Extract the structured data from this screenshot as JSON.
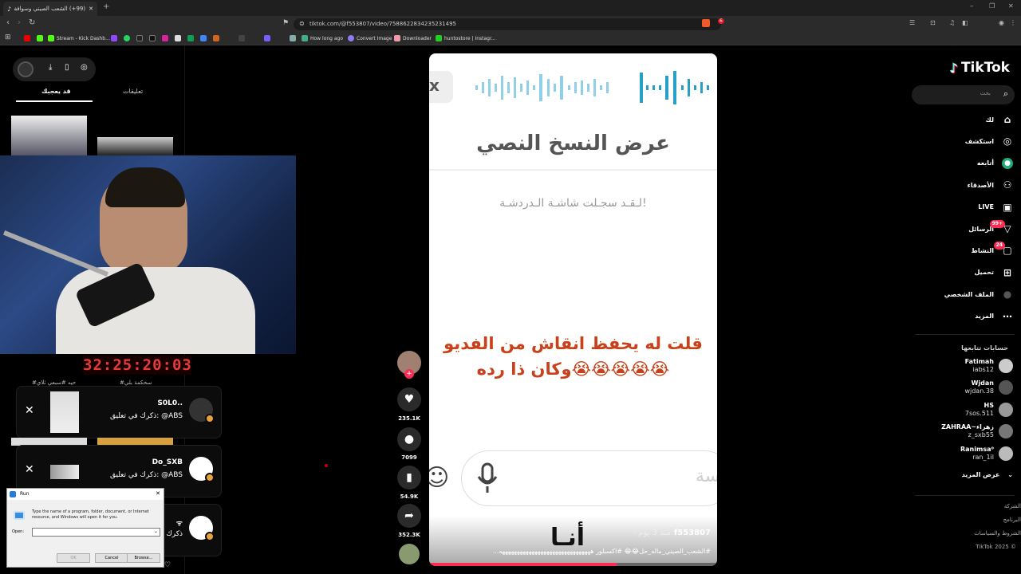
{
  "browser": {
    "tab_title": "(99+) الشعب الصيني وسوافف مثـ",
    "url": "tiktok.com/@f553807/video/7588622834235231495",
    "notif_count": "6",
    "bookmarks": [
      "Stream - Kick Dashb...",
      "How long ago",
      "Convert Image",
      "Downloader",
      "huntostore | Instagr..."
    ]
  },
  "left": {
    "tab_liked": "قد يعجبك",
    "tab_comments": "تعليقات",
    "timer": "32:25:20:03",
    "partial_labels": [
      "#سحكمة بلي",
      "#حيه #سبعي ثلاي"
    ],
    "notifications": [
      {
        "name": "S0L0..",
        "message": "ذكرك في تعليق: @ABS"
      },
      {
        "name": "Do_SXB",
        "message": "ذكرك في تعليق: @ABS"
      },
      {
        "name": "ᯤ",
        "message": "ذكرك"
      }
    ]
  },
  "run_dialog": {
    "title": "Run",
    "description": "Type the name of a program, folder, document, or Internet resource, and Windows will open it for you.",
    "open_label": "Open:",
    "ok": "OK",
    "cancel": "Cancel",
    "browse": "Browse..."
  },
  "video": {
    "close": "x",
    "transcript_title": "عرض النسخ النصي",
    "subtitle": "لـقـد سجـلت شاشـة الـدردشـة!",
    "caption_line1": "قلت له يحفظ انقاش من الفديو",
    "caption_line2": "وكان ذا رده😭😭😭😭😭",
    "bottom_word": "أنـا",
    "partial_word": "سة",
    "author": "f553807",
    "posted": "منذ 3 يوم ·",
    "description": "#الشعب_الصيني_ماله_حل😂😂 #اكسبلور هههههههههههههههههههههههههههههههه...",
    "progress": 0.65
  },
  "actions": {
    "likes": "235.1K",
    "comments": "7099",
    "saves": "54.9K",
    "shares": "352.3K"
  },
  "sidebar": {
    "logo": "TikTok",
    "search_placeholder": "بحث",
    "nav": [
      {
        "label": "لك",
        "icon": "home-icon"
      },
      {
        "label": "استكشف",
        "icon": "compass-icon"
      },
      {
        "label": "أتابعه",
        "icon": "following-icon"
      },
      {
        "label": "الأصدقاء",
        "icon": "friends-icon"
      },
      {
        "label": "LIVE",
        "icon": "live-icon"
      },
      {
        "label": "الرسائل",
        "icon": "messages-icon",
        "badge": "99+"
      },
      {
        "label": "النشاط",
        "icon": "activity-icon",
        "badge": "24"
      },
      {
        "label": "تحميل",
        "icon": "upload-icon"
      },
      {
        "label": "الملف الشخصي",
        "icon": "profile-icon"
      },
      {
        "label": "المزيد",
        "icon": "more-icon"
      }
    ],
    "following_title": "حسابات تتابعها",
    "following": [
      {
        "name": "Fatimah",
        "handle": "iabs12"
      },
      {
        "name": "Wjdan",
        "handle": "wjdan.38"
      },
      {
        "name": "HS",
        "handle": "7sos.511"
      },
      {
        "name": "ZAHRAA~زهراء",
        "handle": "z_sxb55"
      },
      {
        "name": "Ranimsa⁰",
        "handle": "ran_1il"
      }
    ],
    "show_more": "عرض المزيد",
    "footer": [
      "الشركة",
      "البرنامج",
      "الشروط والسياسات",
      "TikTok 2025 ©"
    ]
  },
  "colors": {
    "accent": "#fe2c55",
    "timer": "#e53b3b",
    "progress": "#fe2c55"
  }
}
